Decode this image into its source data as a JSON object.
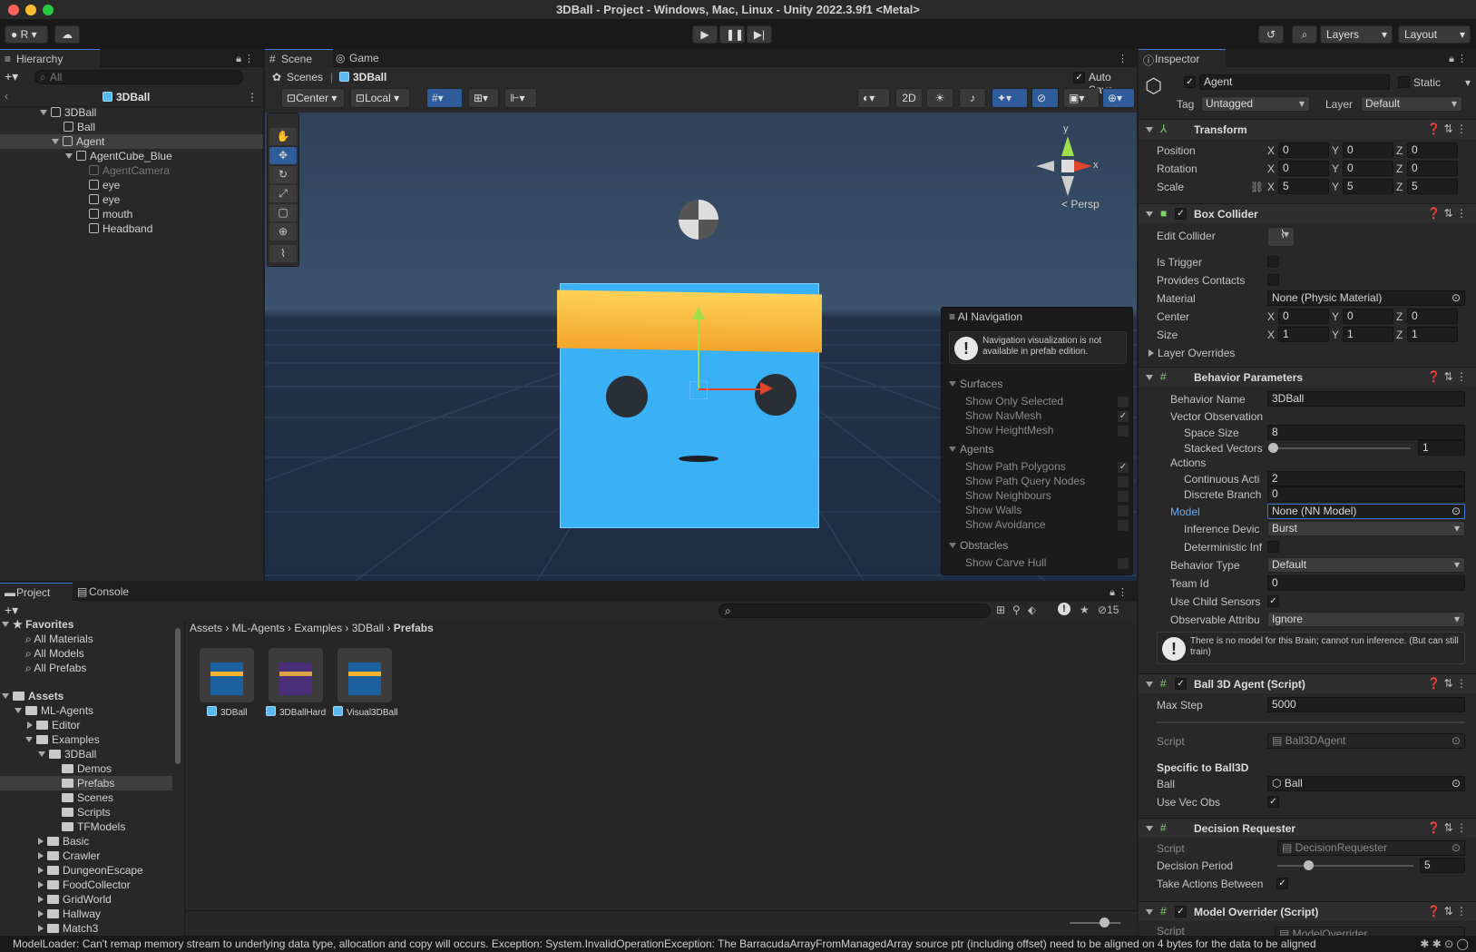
{
  "window": {
    "title": "3DBall - Project - Windows, Mac, Linux - Unity 2022.3.9f1 <Metal>"
  },
  "toolbar": {
    "account_label": "R",
    "layers_label": "Layers",
    "layout_label": "Layout"
  },
  "hierarchy": {
    "tab_label": "Hierarchy",
    "search_placeholder": "All",
    "breadcrumb": "3DBall",
    "items": [
      {
        "label": "3DBall"
      },
      {
        "label": "Ball"
      },
      {
        "label": "Agent"
      },
      {
        "label": "AgentCube_Blue"
      },
      {
        "label": "AgentCamera"
      },
      {
        "label": "eye"
      },
      {
        "label": "eye"
      },
      {
        "label": "mouth"
      },
      {
        "label": "Headband"
      }
    ]
  },
  "scene": {
    "tabs": [
      {
        "label": "Scene"
      },
      {
        "label": "Game"
      }
    ],
    "breadcrumb_root": "Scenes",
    "breadcrumb_current": "3DBall",
    "auto_save_label": "Auto Save",
    "pivot_label": "Center",
    "space_label": "Local",
    "mode_2d_label": "2D",
    "persp_label": "Persp",
    "gizmo_y": "y",
    "gizmo_x": "x"
  },
  "ai_nav": {
    "title": "AI Navigation",
    "warning": "Navigation visualization is not available in prefab edition.",
    "surfaces_header": "Surfaces",
    "surfaces": [
      {
        "label": "Show Only Selected",
        "checked": false
      },
      {
        "label": "Show NavMesh",
        "checked": true
      },
      {
        "label": "Show HeightMesh",
        "checked": false
      }
    ],
    "agents_header": "Agents",
    "agents": [
      {
        "label": "Show Path Polygons",
        "checked": true
      },
      {
        "label": "Show Path Query Nodes",
        "checked": false
      },
      {
        "label": "Show Neighbours",
        "checked": false
      },
      {
        "label": "Show Walls",
        "checked": false
      },
      {
        "label": "Show Avoidance",
        "checked": false
      }
    ],
    "obstacles_header": "Obstacles",
    "obstacles": [
      {
        "label": "Show Carve Hull",
        "checked": false
      }
    ]
  },
  "project": {
    "tabs": [
      {
        "label": "Project"
      },
      {
        "label": "Console"
      }
    ],
    "hidden_count": "15",
    "favorites_header": "Favorites",
    "favorites": [
      {
        "label": "All Materials"
      },
      {
        "label": "All Models"
      },
      {
        "label": "All Prefabs"
      }
    ],
    "assets_header": "Assets",
    "tree": [
      {
        "label": "ML-Agents"
      },
      {
        "label": "Editor"
      },
      {
        "label": "Examples"
      },
      {
        "label": "3DBall"
      },
      {
        "label": "Demos"
      },
      {
        "label": "Prefabs"
      },
      {
        "label": "Scenes"
      },
      {
        "label": "Scripts"
      },
      {
        "label": "TFModels"
      },
      {
        "label": "Basic"
      },
      {
        "label": "Crawler"
      },
      {
        "label": "DungeonEscape"
      },
      {
        "label": "FoodCollector"
      },
      {
        "label": "GridWorld"
      },
      {
        "label": "Hallway"
      },
      {
        "label": "Match3"
      }
    ],
    "path": [
      "Assets",
      "ML-Agents",
      "Examples",
      "3DBall",
      "Prefabs"
    ],
    "assets": [
      {
        "label": "3DBall"
      },
      {
        "label": "3DBallHard"
      },
      {
        "label": "Visual3DBall"
      }
    ]
  },
  "inspector": {
    "tab_label": "Inspector",
    "object_name": "Agent",
    "static_label": "Static",
    "tag_label": "Tag",
    "tag_value": "Untagged",
    "layer_label": "Layer",
    "layer_value": "Default",
    "transform": {
      "title": "Transform",
      "position_label": "Position",
      "rotation_label": "Rotation",
      "scale_label": "Scale",
      "position": [
        "0",
        "0",
        "0"
      ],
      "rotation": [
        "0",
        "0",
        "0"
      ],
      "scale": [
        "5",
        "5",
        "5"
      ]
    },
    "axis": [
      "X",
      "Y",
      "Z"
    ],
    "box_collider": {
      "title": "Box Collider",
      "edit_collider_label": "Edit Collider",
      "is_trigger_label": "Is Trigger",
      "provides_contacts_label": "Provides Contacts",
      "material_label": "Material",
      "material_value": "None (Physic Material)",
      "center_label": "Center",
      "center": [
        "0",
        "0",
        "0"
      ],
      "size_label": "Size",
      "size": [
        "1",
        "1",
        "1"
      ],
      "layer_overrides_label": "Layer Overrides"
    },
    "behavior": {
      "title": "Behavior Parameters",
      "name_label": "Behavior Name",
      "name_value": "3DBall",
      "vector_obs_label": "Vector Observation",
      "space_size_label": "Space Size",
      "space_size_value": "8",
      "stacked_label": "Stacked Vectors",
      "stacked_value": "1",
      "actions_label": "Actions",
      "continuous_label": "Continuous Acti",
      "continuous_value": "2",
      "discrete_label": "Discrete Branch",
      "discrete_value": "0",
      "model_label": "Model",
      "model_value": "None (NN Model)",
      "inference_label": "Inference Devic",
      "inference_value": "Burst",
      "deterministic_label": "Deterministic Inf",
      "type_label": "Behavior Type",
      "type_value": "Default",
      "team_label": "Team Id",
      "team_value": "0",
      "child_sensors_label": "Use Child Sensors",
      "observable_label": "Observable Attribu",
      "observable_value": "Ignore",
      "warning": "There is no model for this Brain; cannot run inference. (But can still train)"
    },
    "agent_script": {
      "title": "Ball 3D Agent (Script)",
      "max_step_label": "Max Step",
      "max_step_value": "5000",
      "script_label": "Script",
      "script_value": "Ball3DAgent",
      "specific_header": "Specific to Ball3D",
      "ball_label": "Ball",
      "ball_value": "Ball",
      "vec_obs_label": "Use Vec Obs"
    },
    "decision": {
      "title": "Decision Requester",
      "script_label": "Script",
      "script_value": "DecisionRequester",
      "period_label": "Decision Period",
      "period_value": "5",
      "take_actions_label": "Take Actions Between"
    },
    "model_override": {
      "title": "Model Overrider (Script)",
      "script_label": "Script",
      "script_value": "ModelOverrider"
    }
  },
  "status_bar": {
    "message": "ModelLoader: Can't remap memory stream to underlying data type, allocation and copy will occurs. Exception: System.InvalidOperationException: The BarracudaArrayFromManagedArray source ptr (including offset) need to be aligned on 4 bytes for the data to be aligned"
  },
  "colors": {
    "accent": "#3b78d6",
    "cube": "#3ab0f5",
    "headband": "#f7b731"
  }
}
